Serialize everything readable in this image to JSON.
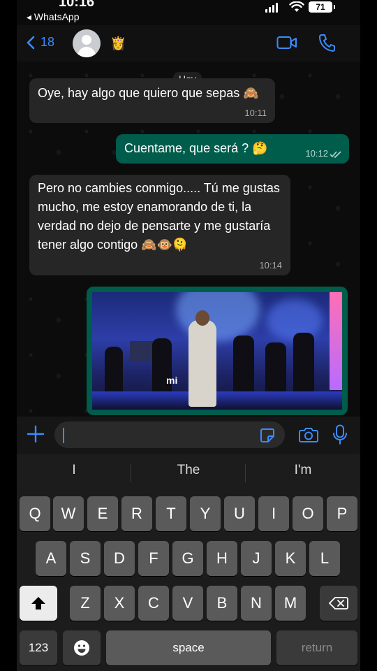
{
  "status_bar": {
    "time": "10:16",
    "back_app": "WhatsApp",
    "battery": "71"
  },
  "header": {
    "back_count": "18",
    "contact_name": "👸"
  },
  "chat": {
    "date_chip": "Hoy",
    "messages": [
      {
        "direction": "in",
        "text": "Oye, hay algo que quiero que sepas 🙈",
        "time": "10:11"
      },
      {
        "direction": "out",
        "text": "Cuentame, que será ? 🤔",
        "time": "10:12"
      },
      {
        "direction": "in",
        "text": "Pero no cambies conmigo..... Tú me gustas mucho, me estoy enamorando de ti, la verdad no dejo de pensarte y me gustaría tener algo contigo 🙈🐵🫠",
        "time": "10:14"
      }
    ],
    "video_caption": "mi"
  },
  "input": {
    "value": "",
    "placeholder": ""
  },
  "keyboard": {
    "suggestions": [
      "I",
      "The",
      "I'm"
    ],
    "row1": [
      "Q",
      "W",
      "E",
      "R",
      "T",
      "Y",
      "U",
      "I",
      "O",
      "P"
    ],
    "row2": [
      "A",
      "S",
      "D",
      "F",
      "G",
      "H",
      "J",
      "K",
      "L"
    ],
    "row3": [
      "Z",
      "X",
      "C",
      "V",
      "B",
      "N",
      "M"
    ],
    "numbers_label": "123",
    "space_label": "space",
    "return_label": "return"
  },
  "colors": {
    "accent": "#3b8cff",
    "outgoing_bubble": "#005c4b",
    "incoming_bubble": "#262626"
  },
  "icons": [
    "back-chevron-icon",
    "video-call-icon",
    "phone-icon",
    "plus-icon",
    "sticker-icon",
    "camera-icon",
    "microphone-icon",
    "shift-icon",
    "backspace-icon",
    "emoji-icon",
    "double-check-icon"
  ]
}
